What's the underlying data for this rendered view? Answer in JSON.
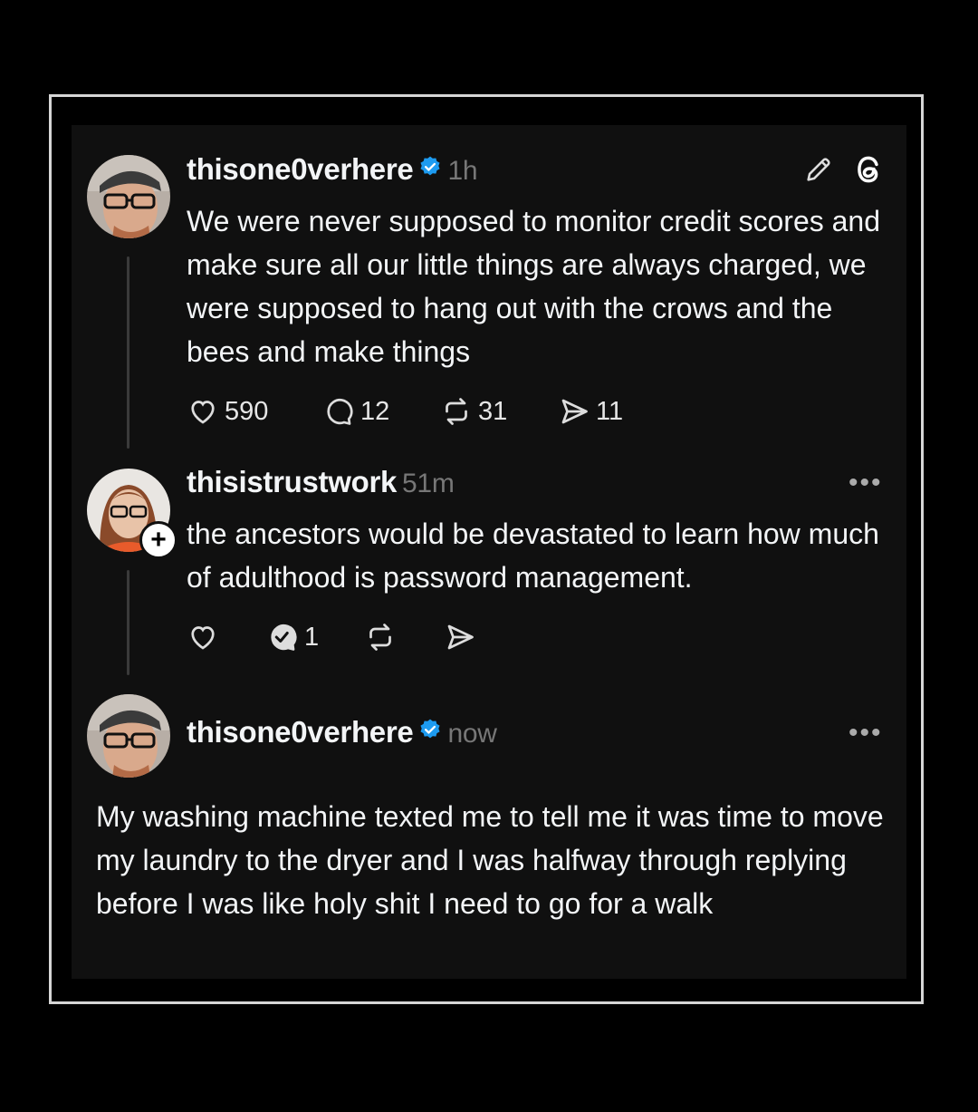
{
  "posts": [
    {
      "username": "thisone0verhere",
      "verified": true,
      "time": "1h",
      "text": "We were never supposed to monitor credit scores and make sure all our little things are always charged, we were supposed to hang out with the crows and the bees and make things",
      "likes": "590",
      "replies": "12",
      "reposts": "31",
      "shares": "11",
      "top_icons": [
        "pencil-icon",
        "threads-logo-icon"
      ]
    },
    {
      "username": "thisistrustwork",
      "verified": false,
      "time": "51m",
      "text": "the ancestors would be devastated to learn how much of adulthood is password management.",
      "likes": "",
      "replies": "1",
      "reposts": "",
      "shares": "",
      "follow_badge": "+",
      "more": "•••"
    },
    {
      "username": "thisone0verhere",
      "verified": true,
      "time": "now",
      "text": "My washing machine texted me to tell me it was time to move my laundry to the dryer and I was halfway through replying before I was like holy shit I need to go for a walk",
      "more": "•••"
    }
  ],
  "colors": {
    "background": "#000000",
    "card": "#101010",
    "text": "#f3f5f7",
    "muted": "#777777",
    "verified": "#1d9bf0",
    "frame": "#d6d6d6"
  }
}
